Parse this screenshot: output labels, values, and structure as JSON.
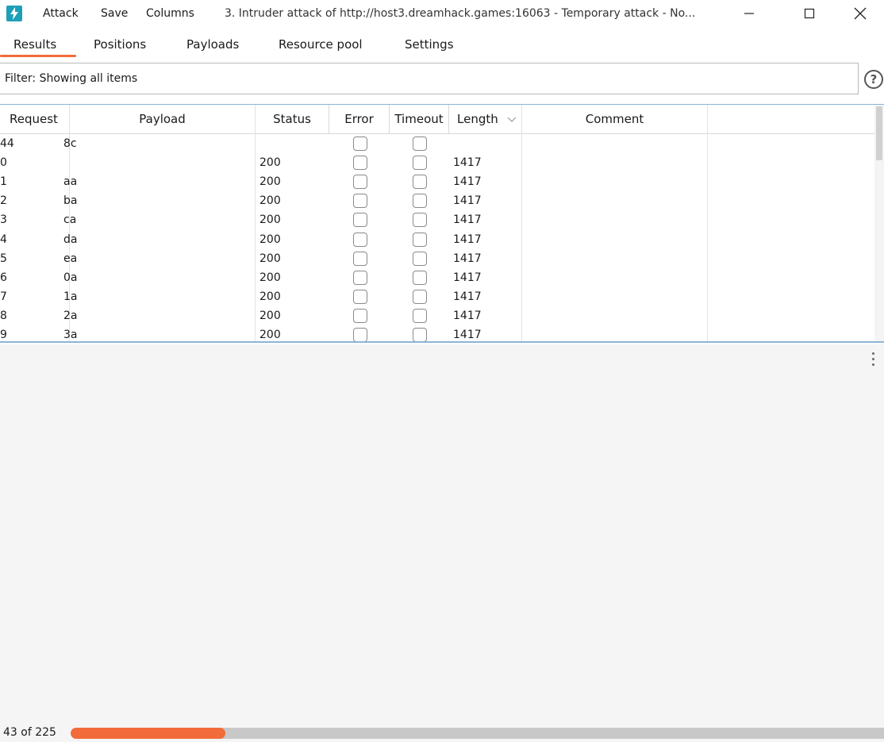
{
  "window": {
    "menus": [
      "Attack",
      "Save",
      "Columns"
    ],
    "title": "3. Intruder attack of http://host3.dreamhack.games:16063 - Temporary attack - No..."
  },
  "tabs": [
    "Results",
    "Positions",
    "Payloads",
    "Resource pool",
    "Settings"
  ],
  "active_tab": "Results",
  "filter": {
    "text": "Filter: Showing all items",
    "help_glyph": "?"
  },
  "table": {
    "columns": [
      "Request",
      "Payload",
      "Status",
      "Error",
      "Timeout",
      "Length",
      "Comment"
    ],
    "sorted_column": "Length",
    "rows": [
      {
        "request": "44",
        "payload": "8c",
        "status": "",
        "length": ""
      },
      {
        "request": "0",
        "payload": "",
        "status": "200",
        "length": "1417"
      },
      {
        "request": "1",
        "payload": "aa",
        "status": "200",
        "length": "1417"
      },
      {
        "request": "2",
        "payload": "ba",
        "status": "200",
        "length": "1417"
      },
      {
        "request": "3",
        "payload": "ca",
        "status": "200",
        "length": "1417"
      },
      {
        "request": "4",
        "payload": "da",
        "status": "200",
        "length": "1417"
      },
      {
        "request": "5",
        "payload": "ea",
        "status": "200",
        "length": "1417"
      },
      {
        "request": "6",
        "payload": "0a",
        "status": "200",
        "length": "1417"
      },
      {
        "request": "7",
        "payload": "1a",
        "status": "200",
        "length": "1417"
      },
      {
        "request": "8",
        "payload": "2a",
        "status": "200",
        "length": "1417"
      },
      {
        "request": "9",
        "payload": "3a",
        "status": "200",
        "length": "1417"
      }
    ]
  },
  "status": {
    "count_text": "43 of 225",
    "progress_fraction": 0.19
  },
  "colors": {
    "accent": "#f26b3a",
    "app_icon": "#1d9fb8",
    "table_border": "#8cb4d8"
  },
  "icons": [
    "burp-app-icon",
    "minimize-icon",
    "maximize-icon",
    "close-icon",
    "help-icon",
    "sort-chevron-icon",
    "more-options-icon"
  ]
}
